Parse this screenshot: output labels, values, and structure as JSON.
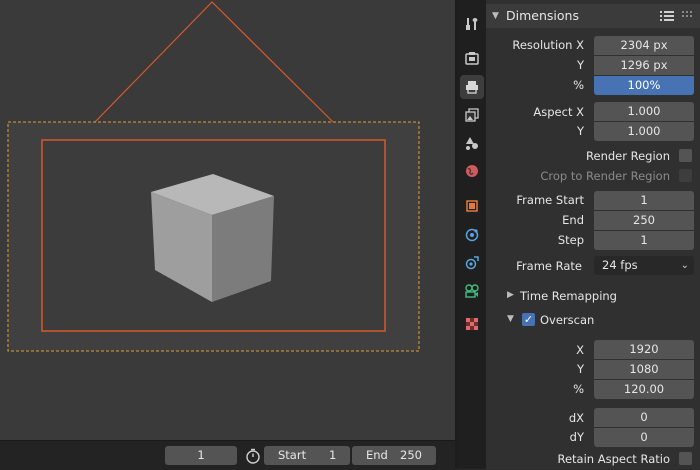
{
  "timeline": {
    "current_frame": "1",
    "start_label": "Start",
    "start_value": "1",
    "end_label": "End",
    "end_value": "250"
  },
  "tabs": [
    {
      "name": "tool-tab",
      "icon": "tool-icon",
      "color": "#c8c8c8"
    },
    {
      "name": "render-tab",
      "icon": "camera-back-icon",
      "color": "#c8c8c8"
    },
    {
      "name": "output-tab",
      "icon": "printer-icon",
      "color": "#c8c8c8",
      "active": true
    },
    {
      "name": "view-layer-tab",
      "icon": "image-stack-icon",
      "color": "#c8c8c8"
    },
    {
      "name": "scene-tab",
      "icon": "scene-icon",
      "color": "#c8c8c8"
    },
    {
      "name": "world-tab",
      "icon": "world-icon",
      "color": "#d35a5a"
    },
    {
      "name": "object-tab",
      "icon": "object-icon",
      "color": "#e07a3a"
    },
    {
      "name": "modifier-tab",
      "icon": "physics-icon",
      "color": "#5ba3e0"
    },
    {
      "name": "particles-tab",
      "icon": "constraint-icon",
      "color": "#5ba3e0"
    },
    {
      "name": "data-tab",
      "icon": "camera-data-icon",
      "color": "#3fbf7f"
    },
    {
      "name": "texture-tab",
      "icon": "checker-icon",
      "color": "#d35a5a"
    }
  ],
  "dimensions": {
    "title": "Dimensions",
    "resolution_x_label": "Resolution X",
    "resolution_x": "2304 px",
    "y_label": "Y",
    "resolution_y": "1296 px",
    "percent_label": "%",
    "percent": "100%",
    "aspect_x_label": "Aspect X",
    "aspect_x": "1.000",
    "aspect_y_label": "Y",
    "aspect_y": "1.000",
    "render_region_label": "Render Region",
    "crop_label": "Crop to Render Region",
    "frame_start_label": "Frame Start",
    "frame_start": "1",
    "end_label": "End",
    "frame_end": "250",
    "step_label": "Step",
    "frame_step": "1",
    "frame_rate_label": "Frame Rate",
    "frame_rate": "24 fps",
    "time_remapping_label": "Time Remapping",
    "overscan_label": "Overscan",
    "overscan_x_label": "X",
    "overscan_x": "1920",
    "overscan_y_label": "Y",
    "overscan_y": "1080",
    "overscan_pct_label": "%",
    "overscan_pct": "120.00",
    "dx_label": "dX",
    "dx": "0",
    "dy_label": "dY",
    "dy": "0",
    "retain_label": "Retain Aspect Ratio"
  },
  "colors": {
    "accent": "#4772b3",
    "frame_orange": "#d9582b"
  }
}
